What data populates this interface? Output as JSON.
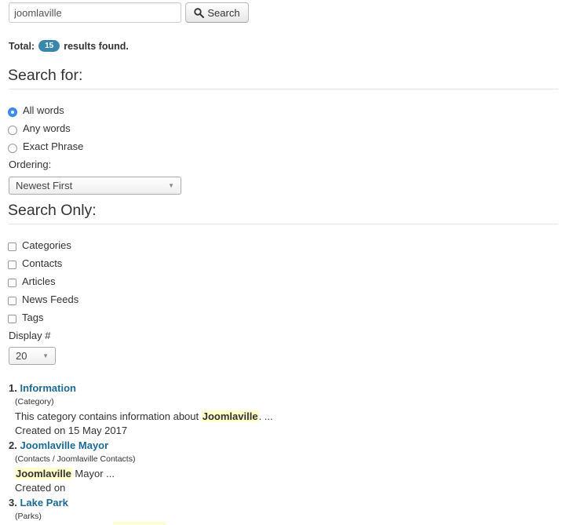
{
  "search": {
    "query": "joomlaville",
    "button_label": "Search",
    "icon": "search-icon"
  },
  "summary": {
    "prefix": "Total:",
    "count": "15",
    "suffix": "results found."
  },
  "search_for": {
    "heading": "Search for:",
    "options": [
      {
        "label": "All words",
        "checked": true
      },
      {
        "label": "Any words",
        "checked": false
      },
      {
        "label": "Exact Phrase",
        "checked": false
      }
    ],
    "ordering_label": "Ordering:",
    "ordering_value": "Newest First"
  },
  "search_only": {
    "heading": "Search Only:",
    "areas": [
      {
        "label": "Categories",
        "checked": false
      },
      {
        "label": "Contacts",
        "checked": false
      },
      {
        "label": "Articles",
        "checked": false
      },
      {
        "label": "News Feeds",
        "checked": false
      },
      {
        "label": "Tags",
        "checked": false
      }
    ],
    "display_label": "Display #",
    "display_value": "20"
  },
  "results": [
    {
      "number": "1.",
      "title": "Information",
      "category": "(Category)",
      "text_before": "This category contains information about ",
      "highlight": "Joomlaville",
      "text_after": ".  ...",
      "created": "Created on 15 May 2017"
    },
    {
      "number": "2.",
      "title": "Joomlaville Mayor",
      "category": "(Contacts / Joomlaville Contacts)",
      "text_before": "",
      "highlight": "Joomlaville",
      "text_after": " Mayor ...",
      "created": "Created on"
    },
    {
      "number": "3.",
      "title": "Lake Park",
      "category": "(Parks)"
    }
  ]
}
